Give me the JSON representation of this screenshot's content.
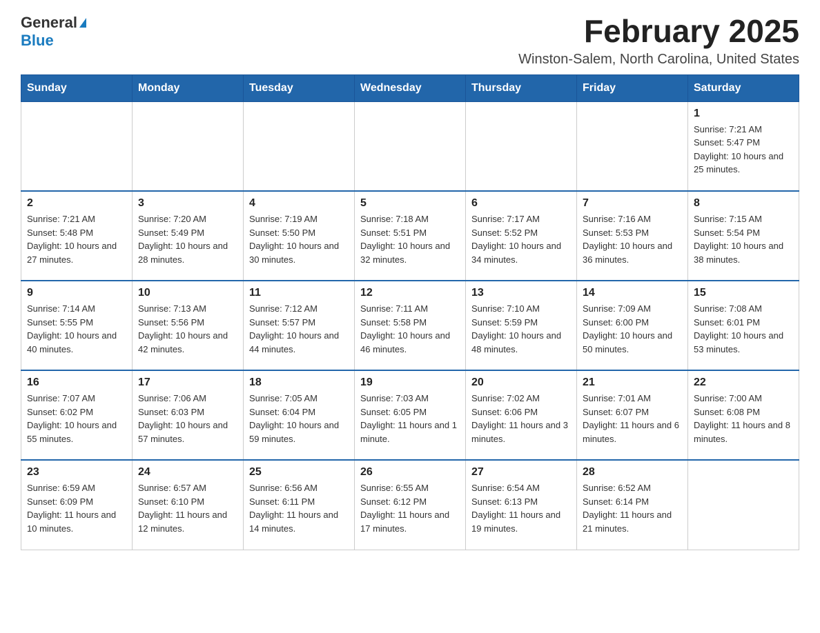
{
  "header": {
    "logo_general": "General",
    "logo_blue": "Blue",
    "month_year": "February 2025",
    "location": "Winston-Salem, North Carolina, United States"
  },
  "days_of_week": [
    "Sunday",
    "Monday",
    "Tuesday",
    "Wednesday",
    "Thursday",
    "Friday",
    "Saturday"
  ],
  "weeks": [
    [
      {
        "day": "",
        "info": ""
      },
      {
        "day": "",
        "info": ""
      },
      {
        "day": "",
        "info": ""
      },
      {
        "day": "",
        "info": ""
      },
      {
        "day": "",
        "info": ""
      },
      {
        "day": "",
        "info": ""
      },
      {
        "day": "1",
        "info": "Sunrise: 7:21 AM\nSunset: 5:47 PM\nDaylight: 10 hours and 25 minutes."
      }
    ],
    [
      {
        "day": "2",
        "info": "Sunrise: 7:21 AM\nSunset: 5:48 PM\nDaylight: 10 hours and 27 minutes."
      },
      {
        "day": "3",
        "info": "Sunrise: 7:20 AM\nSunset: 5:49 PM\nDaylight: 10 hours and 28 minutes."
      },
      {
        "day": "4",
        "info": "Sunrise: 7:19 AM\nSunset: 5:50 PM\nDaylight: 10 hours and 30 minutes."
      },
      {
        "day": "5",
        "info": "Sunrise: 7:18 AM\nSunset: 5:51 PM\nDaylight: 10 hours and 32 minutes."
      },
      {
        "day": "6",
        "info": "Sunrise: 7:17 AM\nSunset: 5:52 PM\nDaylight: 10 hours and 34 minutes."
      },
      {
        "day": "7",
        "info": "Sunrise: 7:16 AM\nSunset: 5:53 PM\nDaylight: 10 hours and 36 minutes."
      },
      {
        "day": "8",
        "info": "Sunrise: 7:15 AM\nSunset: 5:54 PM\nDaylight: 10 hours and 38 minutes."
      }
    ],
    [
      {
        "day": "9",
        "info": "Sunrise: 7:14 AM\nSunset: 5:55 PM\nDaylight: 10 hours and 40 minutes."
      },
      {
        "day": "10",
        "info": "Sunrise: 7:13 AM\nSunset: 5:56 PM\nDaylight: 10 hours and 42 minutes."
      },
      {
        "day": "11",
        "info": "Sunrise: 7:12 AM\nSunset: 5:57 PM\nDaylight: 10 hours and 44 minutes."
      },
      {
        "day": "12",
        "info": "Sunrise: 7:11 AM\nSunset: 5:58 PM\nDaylight: 10 hours and 46 minutes."
      },
      {
        "day": "13",
        "info": "Sunrise: 7:10 AM\nSunset: 5:59 PM\nDaylight: 10 hours and 48 minutes."
      },
      {
        "day": "14",
        "info": "Sunrise: 7:09 AM\nSunset: 6:00 PM\nDaylight: 10 hours and 50 minutes."
      },
      {
        "day": "15",
        "info": "Sunrise: 7:08 AM\nSunset: 6:01 PM\nDaylight: 10 hours and 53 minutes."
      }
    ],
    [
      {
        "day": "16",
        "info": "Sunrise: 7:07 AM\nSunset: 6:02 PM\nDaylight: 10 hours and 55 minutes."
      },
      {
        "day": "17",
        "info": "Sunrise: 7:06 AM\nSunset: 6:03 PM\nDaylight: 10 hours and 57 minutes."
      },
      {
        "day": "18",
        "info": "Sunrise: 7:05 AM\nSunset: 6:04 PM\nDaylight: 10 hours and 59 minutes."
      },
      {
        "day": "19",
        "info": "Sunrise: 7:03 AM\nSunset: 6:05 PM\nDaylight: 11 hours and 1 minute."
      },
      {
        "day": "20",
        "info": "Sunrise: 7:02 AM\nSunset: 6:06 PM\nDaylight: 11 hours and 3 minutes."
      },
      {
        "day": "21",
        "info": "Sunrise: 7:01 AM\nSunset: 6:07 PM\nDaylight: 11 hours and 6 minutes."
      },
      {
        "day": "22",
        "info": "Sunrise: 7:00 AM\nSunset: 6:08 PM\nDaylight: 11 hours and 8 minutes."
      }
    ],
    [
      {
        "day": "23",
        "info": "Sunrise: 6:59 AM\nSunset: 6:09 PM\nDaylight: 11 hours and 10 minutes."
      },
      {
        "day": "24",
        "info": "Sunrise: 6:57 AM\nSunset: 6:10 PM\nDaylight: 11 hours and 12 minutes."
      },
      {
        "day": "25",
        "info": "Sunrise: 6:56 AM\nSunset: 6:11 PM\nDaylight: 11 hours and 14 minutes."
      },
      {
        "day": "26",
        "info": "Sunrise: 6:55 AM\nSunset: 6:12 PM\nDaylight: 11 hours and 17 minutes."
      },
      {
        "day": "27",
        "info": "Sunrise: 6:54 AM\nSunset: 6:13 PM\nDaylight: 11 hours and 19 minutes."
      },
      {
        "day": "28",
        "info": "Sunrise: 6:52 AM\nSunset: 6:14 PM\nDaylight: 11 hours and 21 minutes."
      },
      {
        "day": "",
        "info": ""
      }
    ]
  ]
}
